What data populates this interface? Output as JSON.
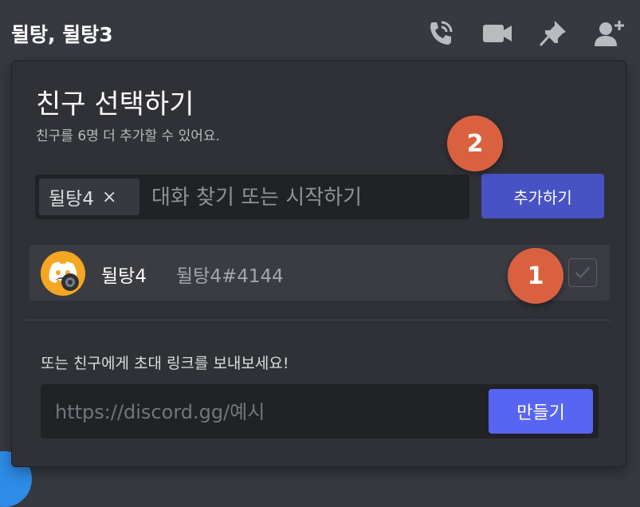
{
  "header": {
    "title": "뒬탕, 뒬탕3",
    "icons": [
      "call-icon",
      "video-icon",
      "pin-icon",
      "add-member-icon"
    ]
  },
  "popup": {
    "title": "친구 선택하기",
    "subtitle": "친구를 6명 더 추가할 수 있어요.",
    "search": {
      "chip_label": "뒬탕4",
      "chip_remove": "×",
      "placeholder": "대화 찾기 또는 시작하기",
      "value": ""
    },
    "add_button": "추가하기",
    "friends": [
      {
        "display_name": "뒬탕4",
        "tag": "뒬탕4#4144",
        "checked": true,
        "status": "offline"
      }
    ],
    "invite": {
      "label": "또는 친구에게 초대 링크를 보내보세요!",
      "placeholder": "https://discord.gg/예시",
      "button": "만들기"
    }
  },
  "annotations": [
    "1",
    "2"
  ],
  "colors": {
    "brand": "#5865f2",
    "add_button": "#4752c4",
    "marker": "#d9613f",
    "avatar": "#f5a623"
  }
}
